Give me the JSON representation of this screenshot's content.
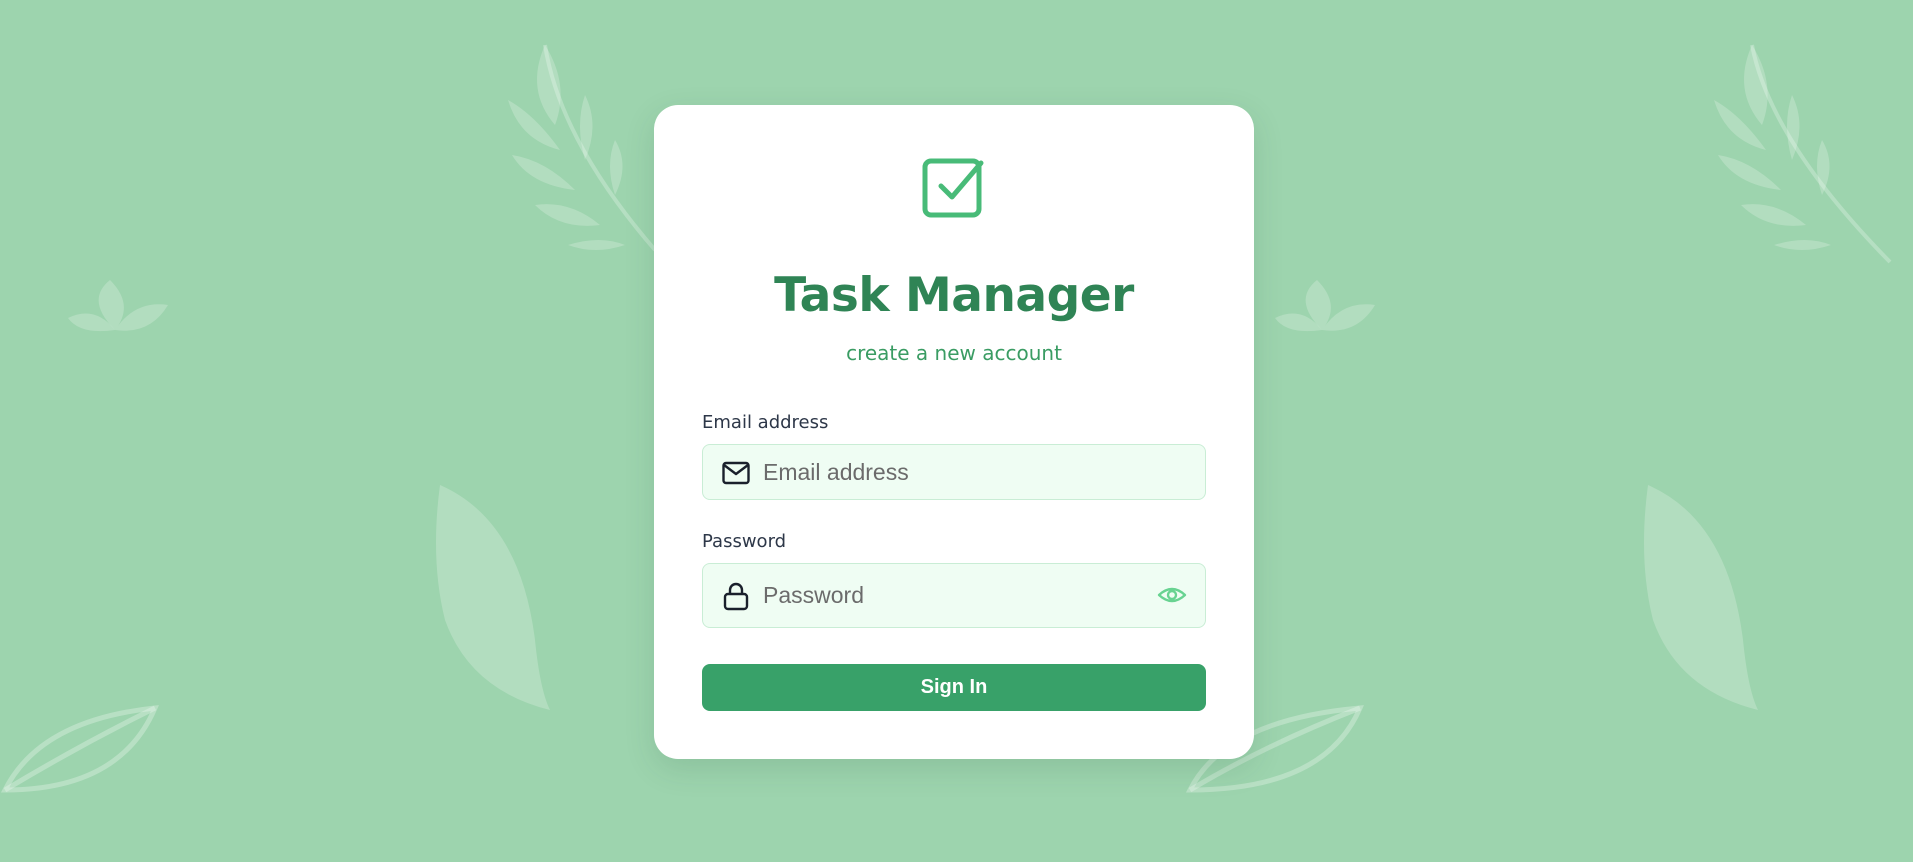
{
  "app": {
    "title": "Task Manager",
    "subtitle": "create a new account",
    "logo_icon": "checkbox-check-icon"
  },
  "form": {
    "email": {
      "label": "Email address",
      "placeholder": "Email address",
      "value": "",
      "icon": "mail-icon"
    },
    "password": {
      "label": "Password",
      "placeholder": "Password",
      "value": "",
      "icon": "lock-icon",
      "toggle_icon": "eye-icon"
    },
    "submit_label": "Sign In"
  },
  "colors": {
    "background": "#9dd4ae",
    "card": "#ffffff",
    "brand_green": "#2f8455",
    "accent_green": "#38a169",
    "input_bg": "#effdf3"
  }
}
